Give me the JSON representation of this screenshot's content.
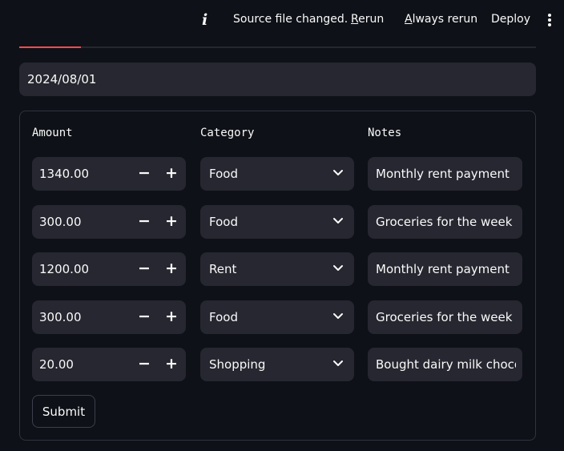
{
  "topbar": {
    "status_text": "Source file changed.",
    "rerun": {
      "accel": "R",
      "rest": "erun"
    },
    "always_rerun": {
      "accel": "A",
      "rest": "lways rerun"
    },
    "deploy": "Deploy"
  },
  "progress": {
    "fraction": 0.12,
    "color": "#ff4b4b"
  },
  "date_value": "2024/08/01",
  "form": {
    "headers": {
      "amount": "Amount",
      "category": "Category",
      "notes": "Notes"
    },
    "minus": "−",
    "plus": "+",
    "rows": [
      {
        "amount": "1340.00",
        "category": "Food",
        "notes": "Monthly rent payment"
      },
      {
        "amount": "300.00",
        "category": "Food",
        "notes": "Groceries for the week"
      },
      {
        "amount": "1200.00",
        "category": "Rent",
        "notes": "Monthly rent payment"
      },
      {
        "amount": "300.00",
        "category": "Food",
        "notes": "Groceries for the week"
      },
      {
        "amount": "20.00",
        "category": "Shopping",
        "notes": "Bought dairy milk choco"
      }
    ],
    "submit_label": "Submit"
  }
}
